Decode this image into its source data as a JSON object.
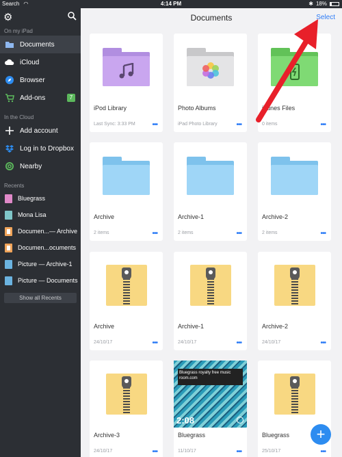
{
  "status": {
    "carrier": "Search",
    "time": "4:14 PM",
    "battery": "18%"
  },
  "sidebar": {
    "on_my_ipad_label": "On my iPad",
    "items": [
      {
        "label": "Documents"
      },
      {
        "label": "iCloud"
      },
      {
        "label": "Browser"
      },
      {
        "label": "Add-ons",
        "badge": "7"
      }
    ],
    "cloud_label": "In the Cloud",
    "cloud_items": [
      {
        "label": "Add account"
      },
      {
        "label": "Log in to Dropbox"
      },
      {
        "label": "Nearby"
      }
    ],
    "recents_label": "Recents",
    "recents": [
      {
        "label": "Bluegrass"
      },
      {
        "label": "Mona Lisa"
      },
      {
        "label": "Documen...— Archive"
      },
      {
        "label": "Documen...ocuments"
      },
      {
        "label": "Picture — Archive-1"
      },
      {
        "label": "Picture — Documents"
      }
    ],
    "show_all": "Show all Recents"
  },
  "header": {
    "title": "Documents",
    "select": "Select"
  },
  "cards": [
    {
      "name": "iPod Library",
      "meta": "Last Sync: 3:33 PM"
    },
    {
      "name": "Photo Albums",
      "meta": "iPad Photo Library"
    },
    {
      "name": "iTunes Files",
      "meta": "0 items"
    },
    {
      "name": "Archive",
      "meta": "2 items"
    },
    {
      "name": "Archive-1",
      "meta": "2 items"
    },
    {
      "name": "Archive-2",
      "meta": "2 items"
    },
    {
      "name": "Archive",
      "meta": "24/10/17"
    },
    {
      "name": "Archive-1",
      "meta": "24/10/17"
    },
    {
      "name": "Archive-2",
      "meta": "24/10/17"
    },
    {
      "name": "Archive-3",
      "meta": "24/10/17"
    },
    {
      "name": "Bluegrass",
      "meta": "11/10/17"
    },
    {
      "name": "Bluegrass",
      "meta": "25/10/17"
    }
  ],
  "video": {
    "banner": "Bluegrass royalty free music room.com",
    "duration": "2:08"
  },
  "more_label": "•••",
  "fab_label": "+",
  "colors": {
    "accent": "#2d7cf6",
    "purple_folder": "#c9a6ef",
    "gray_folder": "#d9d9db",
    "green_folder": "#7fda74",
    "blue_folder": "#8fd0f5",
    "zip": "#f8d882",
    "arrow": "#e8202a"
  }
}
